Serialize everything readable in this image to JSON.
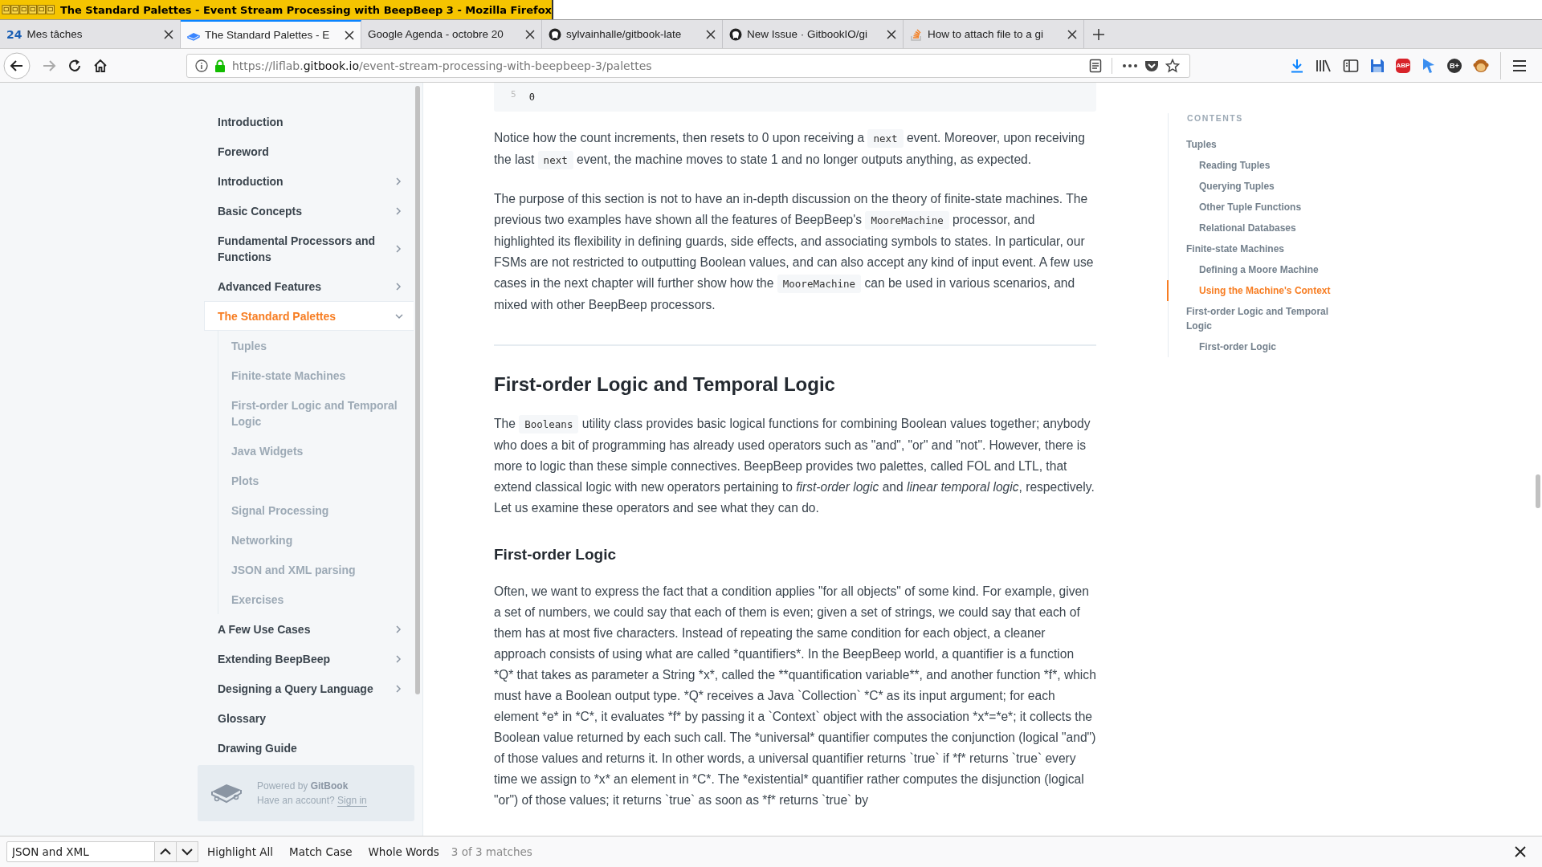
{
  "window": {
    "title": "The Standard Palettes - Event Stream Processing with BeepBeep 3 - Mozilla Firefox"
  },
  "tabs": [
    {
      "label": "Mes tâches",
      "kind": "calendar",
      "badge": "24",
      "selected": false
    },
    {
      "label": "The Standard Palettes - E",
      "kind": "gitbook",
      "selected": true
    },
    {
      "label": "Google Agenda - octobre 20",
      "kind": "plain",
      "selected": false
    },
    {
      "label": "sylvainhalle/gitbook-late",
      "kind": "github",
      "selected": false
    },
    {
      "label": "New Issue · GitbookIO/gi",
      "kind": "github",
      "selected": false
    },
    {
      "label": "How to attach file to a gi",
      "kind": "stack",
      "selected": false
    }
  ],
  "address_bar": {
    "prefix": "https://liflab.",
    "domain": "gitbook.io",
    "path": "/event-stream-processing-with-beepbeep-3/palettes"
  },
  "toolbar_badges": {
    "adblock": "ABP",
    "bplus": "B+"
  },
  "sidebar": {
    "items": [
      {
        "label": "Introduction",
        "kind": "page",
        "selected": false
      },
      {
        "label": "Foreword",
        "kind": "page",
        "selected": false
      },
      {
        "label": "Introduction",
        "kind": "group",
        "expanded": false,
        "selected": false
      },
      {
        "label": "Basic Concepts",
        "kind": "group",
        "expanded": false,
        "selected": false
      },
      {
        "label": "Fundamental Processors and Functions",
        "kind": "group",
        "expanded": false,
        "selected": false
      },
      {
        "label": "Advanced Features",
        "kind": "group",
        "expanded": false,
        "selected": false
      },
      {
        "label": "The Standard Palettes",
        "kind": "group",
        "expanded": true,
        "selected": true,
        "children": [
          {
            "label": "Tuples",
            "selected": false
          },
          {
            "label": "Finite-state Machines",
            "selected": false
          },
          {
            "label": "First-order Logic and Temporal Logic",
            "selected": false
          },
          {
            "label": "Java Widgets",
            "selected": false
          },
          {
            "label": "Plots",
            "selected": false
          },
          {
            "label": "Signal Processing",
            "selected": false
          },
          {
            "label": "Networking",
            "selected": false
          },
          {
            "label": "JSON and XML parsing",
            "selected": false
          },
          {
            "label": "Exercises",
            "selected": false
          }
        ]
      },
      {
        "label": "A Few Use Cases",
        "kind": "group",
        "expanded": false,
        "selected": false
      },
      {
        "label": "Extending BeepBeep",
        "kind": "group",
        "expanded": false,
        "selected": false
      },
      {
        "label": "Designing a Query Language",
        "kind": "group",
        "expanded": false,
        "selected": false
      },
      {
        "label": "Glossary",
        "kind": "page",
        "selected": false
      },
      {
        "label": "Drawing Guide",
        "kind": "page",
        "selected": false
      }
    ],
    "footer": {
      "powered": "Powered by",
      "brand": "GitBook",
      "account": "Have an account?",
      "sign_in": "Sign in"
    }
  },
  "code_block": {
    "line_number": "5",
    "code": "0"
  },
  "article": [
    {
      "kind": "paragraph",
      "parts": [
        {
          "kind": "text",
          "text": "Notice how the count increments, then resets to 0 upon receiving a "
        },
        {
          "kind": "code",
          "text": "next"
        },
        {
          "kind": "text",
          "text": " event. Moreover, upon receiving the last "
        },
        {
          "kind": "code",
          "text": "next"
        },
        {
          "kind": "text",
          "text": " event, the machine moves to state 1 and no longer outputs anything, as expected."
        }
      ]
    },
    {
      "kind": "paragraph",
      "parts": [
        {
          "kind": "text",
          "text": "The purpose of this section is not to have an in-depth discussion on the theory of finite-state machines. The previous two examples have shown all the features of BeepBeep's "
        },
        {
          "kind": "code",
          "text": "MooreMachine"
        },
        {
          "kind": "text",
          "text": " processor, and highlighted its flexibility in defining guards, side effects, and associating symbols to states. In particular, our FSMs are not restricted to outputting Boolean values, and can also accept any kind of input event. A few use cases in the next chapter will further show how the "
        },
        {
          "kind": "code",
          "text": "MooreMachine"
        },
        {
          "kind": "text",
          "text": " can be used in various scenarios, and mixed with other BeepBeep processors."
        }
      ]
    },
    {
      "kind": "rule"
    },
    {
      "kind": "h2",
      "text": "First-order Logic and Temporal Logic"
    },
    {
      "kind": "paragraph",
      "parts": [
        {
          "kind": "text",
          "text": "The "
        },
        {
          "kind": "code",
          "text": "Booleans"
        },
        {
          "kind": "text",
          "text": " utility class provides basic logical functions for combining Boolean values together; anybody who does a bit of programming has already used operators such as \"and\", \"or\" and \"not\". However, there is more to logic than these simple connectives. BeepBeep provides two palettes, called FOL and LTL, that extend classical logic with new operators pertaining to "
        },
        {
          "kind": "em",
          "text": "first-order logic"
        },
        {
          "kind": "text",
          "text": " and "
        },
        {
          "kind": "em",
          "text": "linear temporal logic"
        },
        {
          "kind": "text",
          "text": ", respectively. Let us examine these operators and see what they can do."
        }
      ]
    },
    {
      "kind": "h3",
      "text": "First-order Logic"
    },
    {
      "kind": "paragraph",
      "parts": [
        {
          "kind": "text",
          "text": "Often, we want to express the fact that a condition applies \"for all objects\" of some kind. For example, given a set of numbers, we could say that each of them is even; given a set of strings, we could say that each of them has at most five characters. Instead of repeating the same condition for each object, a cleaner approach consists of using what are called *quantifiers*. In the BeepBeep world, a quantifier is a function *Q* that takes as parameter a String *x*, called the **quantification variable**, and another function *f*, which must have a Boolean output type. *Q* receives a Java `Collection` *C* as its input argument; for each element *e* in *C*, it evaluates *f* by passing it a `Context` object with the association *x*=*e*; it collects the Boolean value returned by each such call. The *universal* quantifier computes the conjunction (logical \"and\") of those values and returns it. In other words, a universal quantifier returns `true` if *f* returns `true` every time we assign to *x* an element in *C*. The *existential* quantifier rather computes the disjunction (logical \"or\") of those values; it returns `true` as soon as *f* returns `true` by"
        }
      ]
    }
  ],
  "contents": {
    "heading": "CONTENTS",
    "items": [
      {
        "label": "Tuples",
        "selected": false,
        "children": [
          {
            "label": "Reading Tuples",
            "selected": false
          },
          {
            "label": "Querying Tuples",
            "selected": false
          },
          {
            "label": "Other Tuple Functions",
            "selected": false
          },
          {
            "label": "Relational Databases",
            "selected": false
          }
        ]
      },
      {
        "label": "Finite-state Machines",
        "selected": false,
        "children": [
          {
            "label": "Defining a Moore Machine",
            "selected": false
          },
          {
            "label": "Using the Machine's Context",
            "selected": true
          }
        ]
      },
      {
        "label": "First-order Logic and Temporal Logic",
        "selected": false,
        "children": [
          {
            "label": "First-order Logic",
            "selected": false
          }
        ]
      }
    ]
  },
  "find_bar": {
    "value": "JSON and XML",
    "options": [
      "Highlight All",
      "Match Case",
      "Whole Words"
    ],
    "status": "3 of 3 matches"
  }
}
